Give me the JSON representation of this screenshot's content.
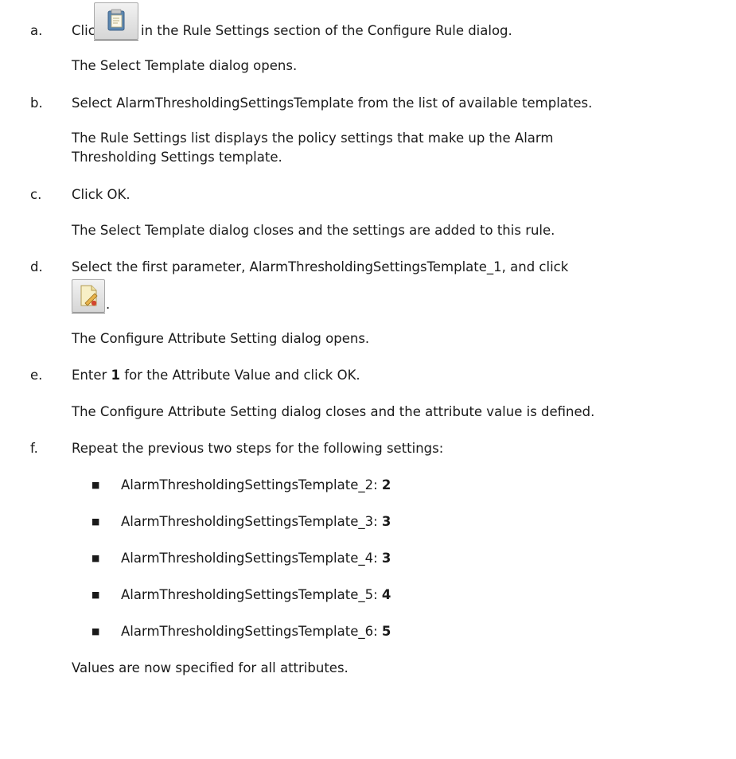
{
  "steps": {
    "a": {
      "letter": "a.",
      "before_icon": "Click",
      "after_icon": "in the Rule Settings section of the Configure Rule dialog.",
      "icon": "select-template-icon",
      "result": "The Select Template dialog opens."
    },
    "b": {
      "letter": "b.",
      "text": "Select AlarmThresholdingSettingsTemplate from the list of available templates.",
      "result_line1": "The Rule Settings list displays the policy settings that make up the Alarm",
      "result_line2": "Thresholding Settings template."
    },
    "c": {
      "letter": "c.",
      "text": "Click OK.",
      "result": "The Select Template dialog closes and the settings are added to this rule."
    },
    "d": {
      "letter": "d.",
      "text": "Select the first parameter, AlarmThresholdingSettingsTemplate_1, and click",
      "icon": "configure-attribute-icon",
      "trailing": ".",
      "result": "The Configure Attribute Setting dialog opens."
    },
    "e": {
      "letter": "e.",
      "prefix": "Enter ",
      "value": "1",
      "suffix": " for the Attribute Value and click OK.",
      "result": "The Configure Attribute Setting dialog closes and the attribute value is defined."
    },
    "f": {
      "letter": "f.",
      "text": "Repeat the previous two steps for the following settings:",
      "bullet_glyph": "■",
      "settings": [
        {
          "name": "AlarmThresholdingSettingsTemplate_2: ",
          "value": "2"
        },
        {
          "name": "AlarmThresholdingSettingsTemplate_3: ",
          "value": "3"
        },
        {
          "name": "AlarmThresholdingSettingsTemplate_4: ",
          "value": "3"
        },
        {
          "name": "AlarmThresholdingSettingsTemplate_5: ",
          "value": "4"
        },
        {
          "name": "AlarmThresholdingSettingsTemplate_6: ",
          "value": "5"
        }
      ],
      "result": "Values are now specified for all attributes."
    }
  }
}
